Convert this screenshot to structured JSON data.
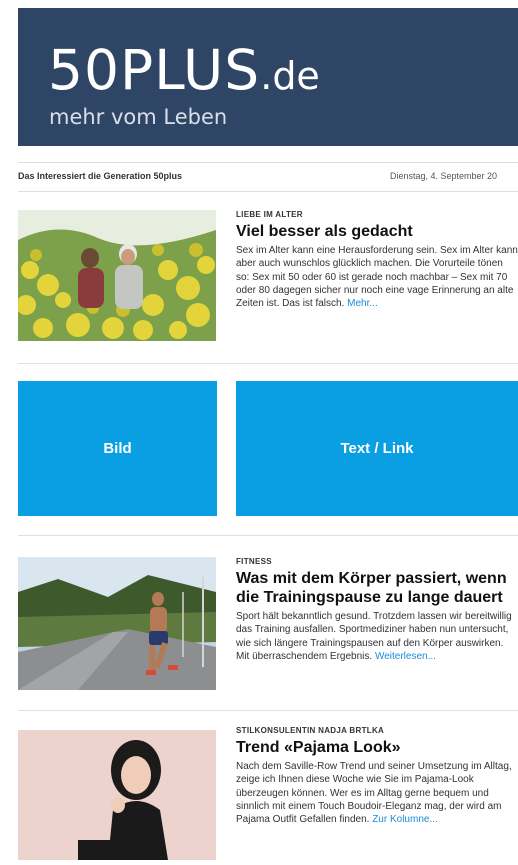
{
  "header": {
    "logo_main": "50PLUS",
    "logo_suffix": ".de",
    "tagline": "mehr vom Leben",
    "background": "#2f4566"
  },
  "topbar": {
    "left_text": "Das Interessiert die Generation 50plus",
    "date_text": "Dienstag, 4. September 20"
  },
  "articles": [
    {
      "kicker": "LIEBE IM ALTER",
      "headline": "Viel besser als gedacht",
      "body": "Sex im Alter kann eine Herausforderung sein. Sex im Alter kann aber auch wunschlos glücklich machen. Die Vorurteile tönen so: Sex mit 50 oder 60 ist gerade noch machbar – Sex mit 70 oder 80 dagegen sicher nur noch eine vage Erinnerung an alte Zeiten ist. Das ist falsch.",
      "more": "Mehr..."
    },
    {
      "kicker": "FITNESS",
      "headline": "Was mit dem Körper passiert, wenn die Trainingspause zu lange dauert",
      "body": "Sport hält bekanntlich gesund. Trotzdem lassen wir bereitwillig das Training ausfallen. Sportmediziner haben nun untersucht, wie sich längere Trainingspausen auf den Körper auswirken. Mit überraschendem Ergebnis.",
      "more": "Weiterlesen..."
    },
    {
      "kicker": "STILKONSULENTIN NADJA BRTLKA",
      "headline": "Trend «Pajama Look»",
      "body": "Nach dem Saville-Row Trend und seiner Umsetzung im Alltag, zeige ich Ihnen diese Woche wie Sie im Pajama-Look überzeugen können. Wer es im Alltag gerne bequem und sinnlich mit einem Touch Boudoir-Eleganz mag, der wird am Pajama Outfit Gefallen finden.",
      "more": "Zur Kolumne..."
    }
  ],
  "placeholders": {
    "image_label": "Bild",
    "text_label": "Text / Link",
    "color": "#0a9fe3"
  },
  "icons": [
    "couple-in-field-photo",
    "runner-photo",
    "woman-portrait-photo"
  ]
}
